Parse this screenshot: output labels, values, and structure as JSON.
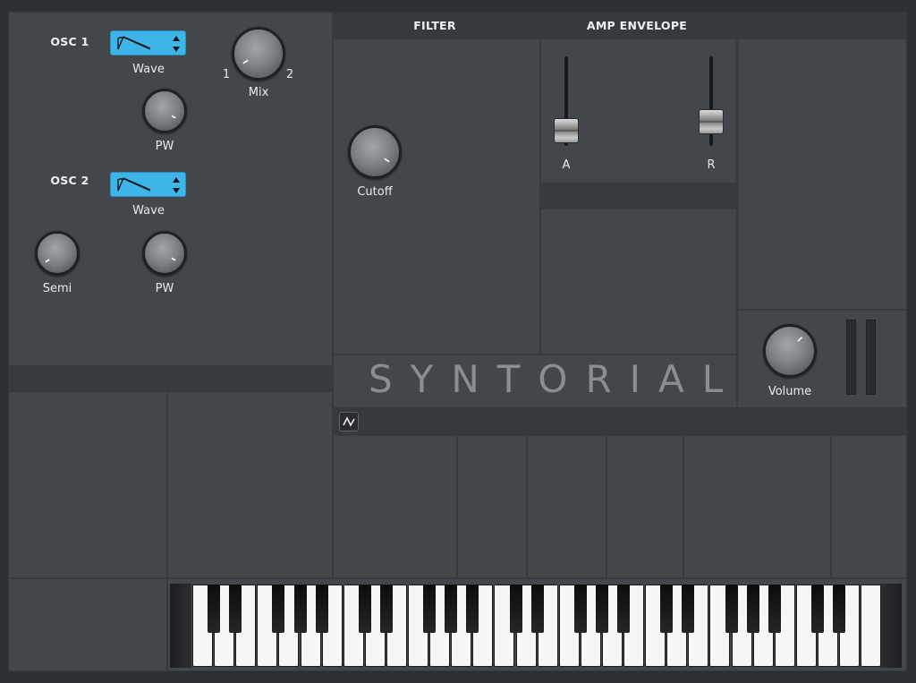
{
  "app": {
    "logo": "SYNTORIAL"
  },
  "osc1": {
    "title": "OSC 1",
    "wave_label": "Wave",
    "pw_label": "PW",
    "mix_label": "Mix",
    "mix_min": "1",
    "mix_max": "2"
  },
  "osc2": {
    "title": "OSC 2",
    "wave_label": "Wave",
    "semi_label": "Semi",
    "pw_label": "PW"
  },
  "filter": {
    "title": "FILTER",
    "cutoff_label": "Cutoff"
  },
  "amp_envelope": {
    "title": "AMP ENVELOPE",
    "attack_label": "A",
    "release_label": "R"
  },
  "master": {
    "volume_label": "Volume"
  },
  "colors": {
    "accent": "#3fb4e8",
    "panel": "#43474c",
    "background": "#2d3034",
    "logo": "#8a8e93"
  },
  "icons": {
    "wave_shape": "saw-wave-icon",
    "dropdown": "up-down-arrows-icon",
    "lfo_toggle": "waveform-icon"
  },
  "keyboard": {
    "white_keys": 32,
    "black_key_pattern": "C D F G A repeating"
  }
}
